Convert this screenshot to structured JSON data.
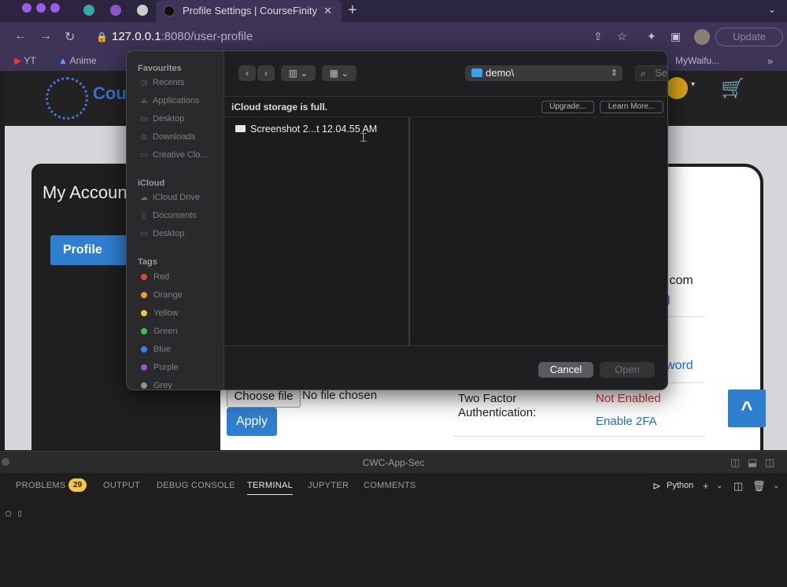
{
  "browser": {
    "tab_title": "Profile Settings | CourseFinity",
    "url_host": "127.0.0.1",
    "url_path": ":8080/user-profile",
    "update_label": "Update",
    "bookmarks": [
      "YT",
      "Anime",
      "MyWaifu..."
    ]
  },
  "page": {
    "logo_text": "Cou",
    "my_account": "My Accoun",
    "profile_tab": "Profile",
    "email_fragment": ".com",
    "email_link_fragment": "l",
    "password_link_fragment": "word",
    "choose_file_label": "Choose file",
    "no_file_label": "No file chosen",
    "apply_label": "Apply",
    "two_factor_label": "Two Factor Authentication:",
    "two_factor_status": "Not Enabled",
    "enable_2fa_label": "Enable 2FA",
    "scroll_top_glyph": "^"
  },
  "dialog": {
    "favourites_heading": "Favourites",
    "favourites": [
      "Recents",
      "Applications",
      "Desktop",
      "Downloads",
      "Creative Clo..."
    ],
    "icloud_heading": "iCloud",
    "icloud_items": [
      "iCloud Drive",
      "Documents",
      "Desktop"
    ],
    "tags_heading": "Tags",
    "tags": [
      {
        "label": "Red",
        "color": "#e0463c"
      },
      {
        "label": "Orange",
        "color": "#f09b2a"
      },
      {
        "label": "Yellow",
        "color": "#e9c83a"
      },
      {
        "label": "Green",
        "color": "#3fbf54"
      },
      {
        "label": "Blue",
        "color": "#3b82e8"
      },
      {
        "label": "Purple",
        "color": "#a04fd2"
      },
      {
        "label": "Grey",
        "color": "#8e8e93"
      }
    ],
    "location": "demo\\",
    "search_placeholder": "Search",
    "icloud_message": "iCloud storage is full.",
    "upgrade_label": "Upgrade...",
    "learn_more_label": "Learn More...",
    "file_name": "Screenshot 2...t 12.04.55 AM",
    "cancel_label": "Cancel",
    "open_label": "Open"
  },
  "vscode": {
    "window_title": "CWC-App-Sec",
    "tabs": [
      "PROBLEMS",
      "OUTPUT",
      "DEBUG CONSOLE",
      "TERMINAL",
      "JUPYTER",
      "COMMENTS"
    ],
    "problems_count": "29",
    "shell_label": "Python"
  }
}
